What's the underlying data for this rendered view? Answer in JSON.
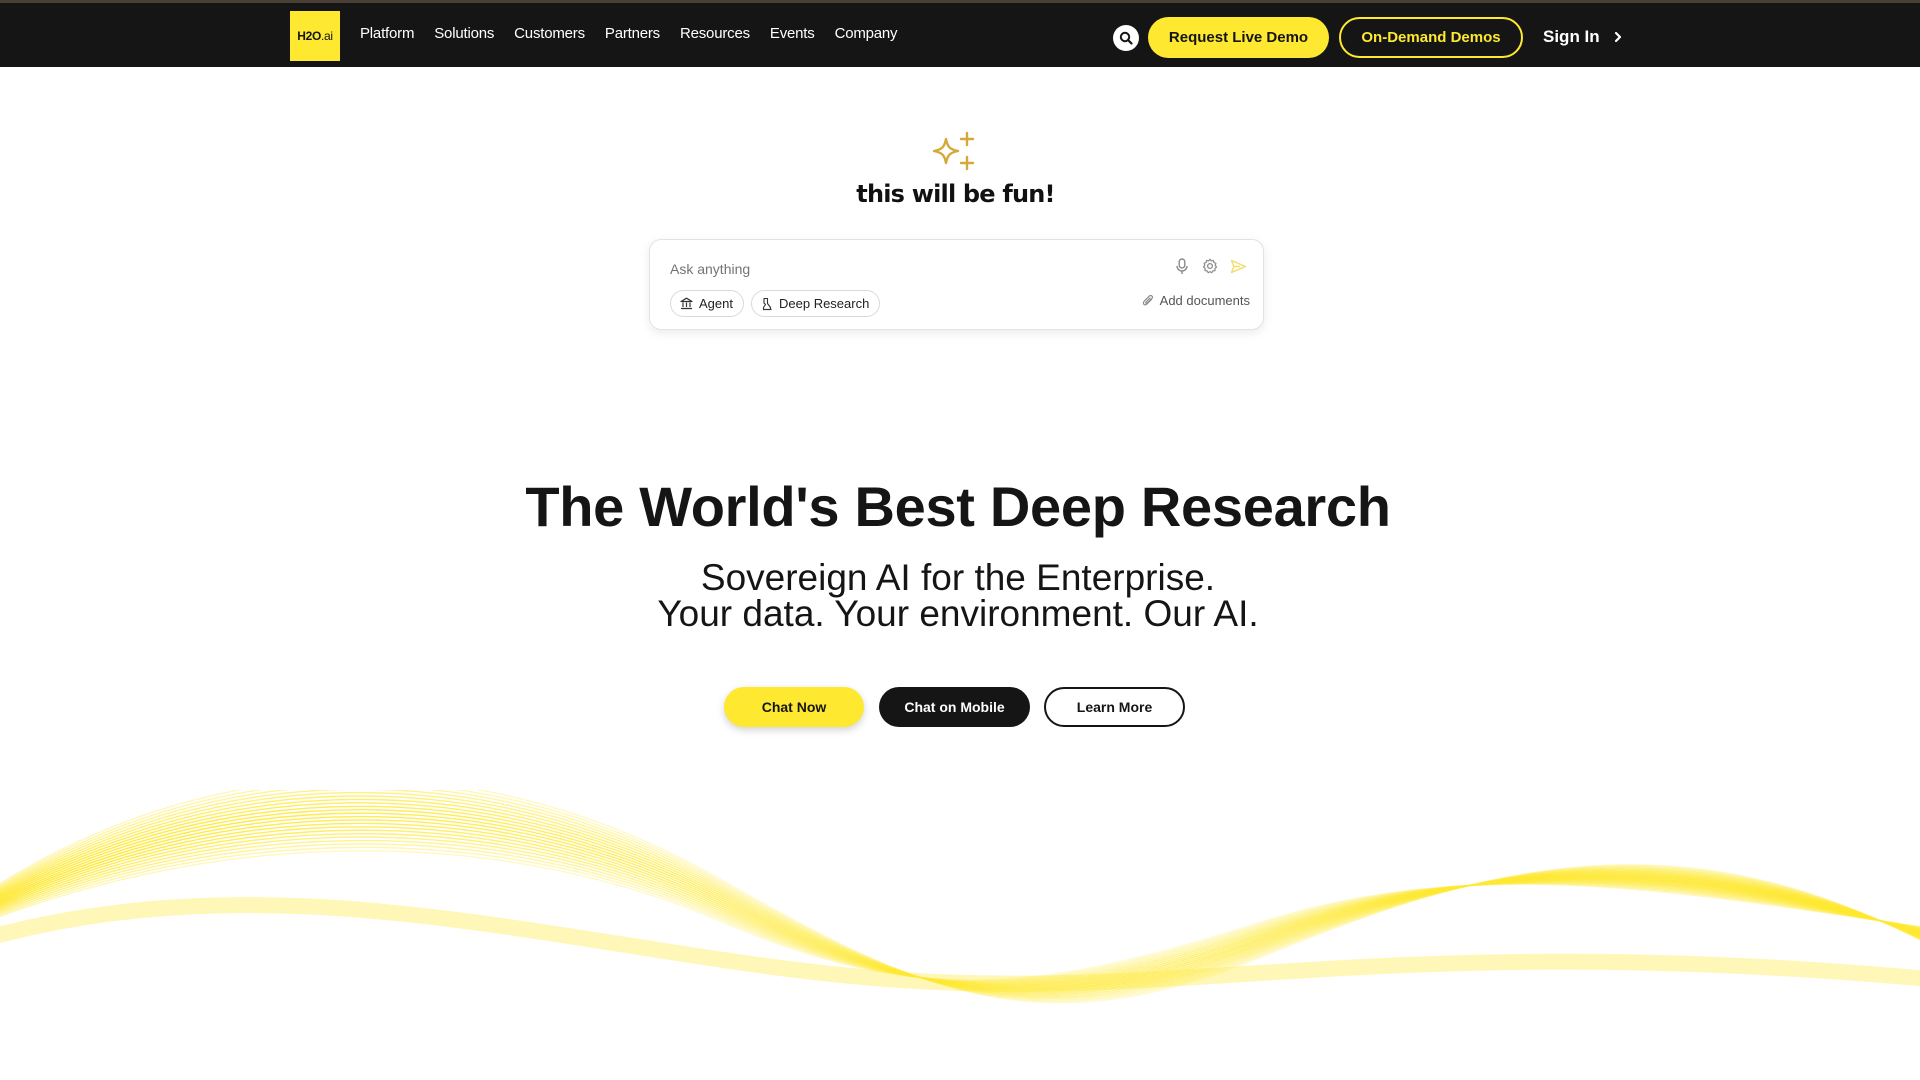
{
  "nav": {
    "logo_main": "H2O",
    "logo_suffix": ".ai",
    "links": [
      "Platform",
      "Solutions",
      "Customers",
      "Partners",
      "Resources",
      "Events",
      "Company"
    ],
    "search_icon": "search-icon",
    "request_demo_label": "Request Live Demo",
    "on_demand_label": "On-Demand Demos",
    "sign_in_label": "Sign In",
    "sign_in_icon": "chevron-right-icon"
  },
  "hero": {
    "sparkle_icon": "sparkle-icon",
    "tagline": "this will be fun!"
  },
  "chat": {
    "placeholder": "Ask anything",
    "value": "",
    "icons": [
      "microphone-icon",
      "settings-icon",
      "send-icon"
    ],
    "chips": [
      {
        "label": "Agent",
        "icon": "bank-icon"
      },
      {
        "label": "Deep Research",
        "icon": "research-icon"
      }
    ],
    "add_documents_label": "Add documents",
    "add_documents_icon": "paperclip-icon"
  },
  "main": {
    "headline": "The World's Best Deep Research",
    "subline1": "Sovereign AI for the Enterprise.",
    "subline2": "Your data. Your environment. Our AI.",
    "cta_chat": "Chat Now",
    "cta_mobile": "Chat on Mobile",
    "cta_learn": "Learn More"
  },
  "colors": {
    "brand_yellow": "#fee830",
    "nav_background": "#151515",
    "sparkle_gold": "#d4a93a",
    "text_dark": "#151515"
  }
}
